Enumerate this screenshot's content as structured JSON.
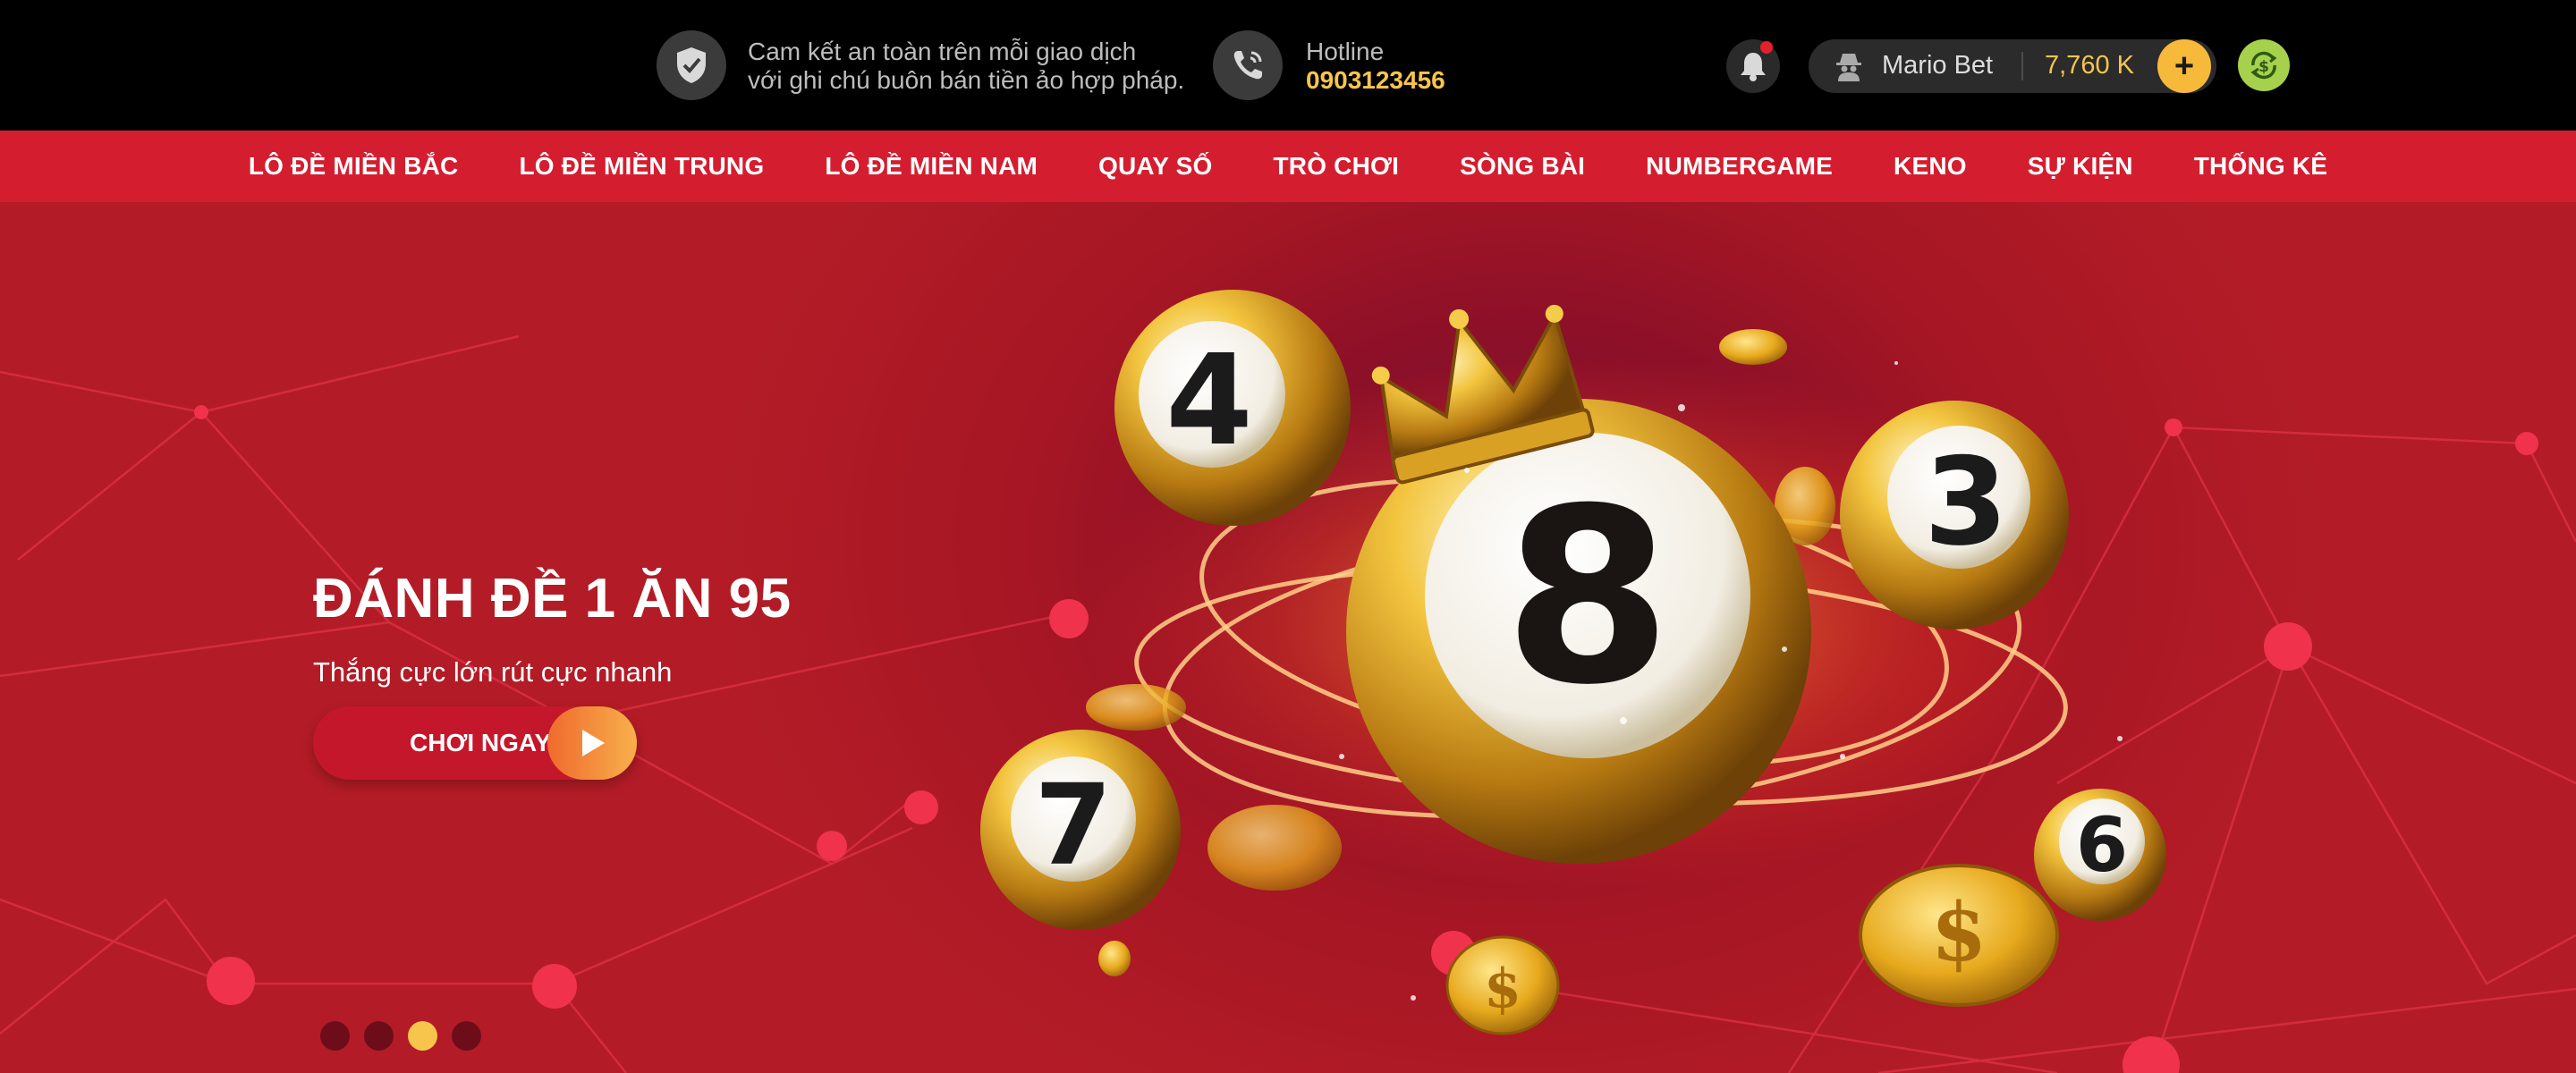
{
  "topbar": {
    "trust_line1": "Cam kết an toàn trên mỗi giao dịch",
    "trust_line2": "với ghi chú buôn bán tiền ảo hợp pháp.",
    "hotline_label": "Hotline",
    "hotline_number": "0903123456",
    "username": "Mario Bet",
    "balance": "7,760 K",
    "plus_label": "+"
  },
  "nav": {
    "items": [
      "LÔ ĐỀ MIỀN BẮC",
      "LÔ ĐỀ MIỀN TRUNG",
      "LÔ ĐỀ MIỀN NAM",
      "QUAY SỐ",
      "TRÒ CHƠI",
      "SÒNG BÀI",
      "NUMBERGAME",
      "KENO",
      "SỰ KIỆN",
      "THỐNG KÊ"
    ]
  },
  "hero": {
    "title": "ĐÁNH ĐỀ 1 ĂN 95",
    "subtitle": "Thắng cực lớn rút cực nhanh",
    "cta_label": "CHƠI NGAY",
    "balls": [
      "8",
      "4",
      "3",
      "7",
      "6"
    ],
    "slides_total": 4,
    "active_slide": 3
  },
  "colors": {
    "brand_red": "#d41e30",
    "gold": "#f7c54b",
    "green": "#a6d14c"
  },
  "icons": [
    "shield-check-icon",
    "phone-icon",
    "bell-icon",
    "user-spy-icon",
    "plus-icon",
    "money-exchange-icon",
    "play-icon",
    "crown-icon"
  ]
}
